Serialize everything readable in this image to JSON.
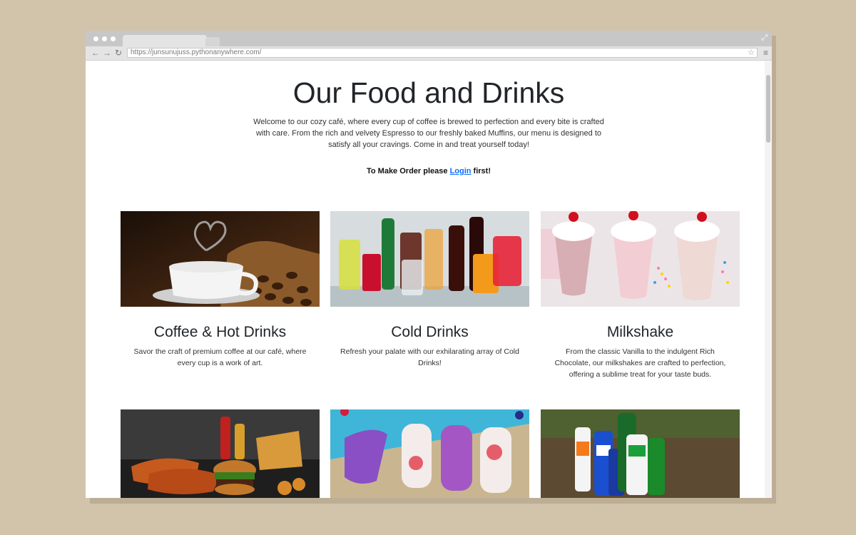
{
  "browser": {
    "url": "https://junsunujuss.pythonanywhere.com/"
  },
  "page": {
    "title": "Our Food and Drinks",
    "intro": "Welcome to our cozy café, where every cup of coffee is brewed to perfection and every bite is crafted with care. From the rich and velvety Espresso to our freshly baked Muffins, our menu is designed to satisfy all your cravings. Come in and treat yourself today!",
    "order_prefix": "To Make Order please ",
    "login_link": "Login",
    "order_suffix": " first!"
  },
  "categories": [
    {
      "title": "Coffee & Hot Drinks",
      "description": "Savor the craft of premium coffee at our café, where every cup is a work of art."
    },
    {
      "title": "Cold Drinks",
      "description": "Refresh your palate with our exhilarating array of Cold Drinks!"
    },
    {
      "title": "Milkshake",
      "description": "From the classic Vanilla to the indulgent Rich Chocolate, our milkshakes are crafted to perfection, offering a sublime treat for your taste buds."
    }
  ],
  "colors": {
    "background": "#d2c3ab",
    "link": "#0d6efd",
    "heading": "#212529"
  }
}
